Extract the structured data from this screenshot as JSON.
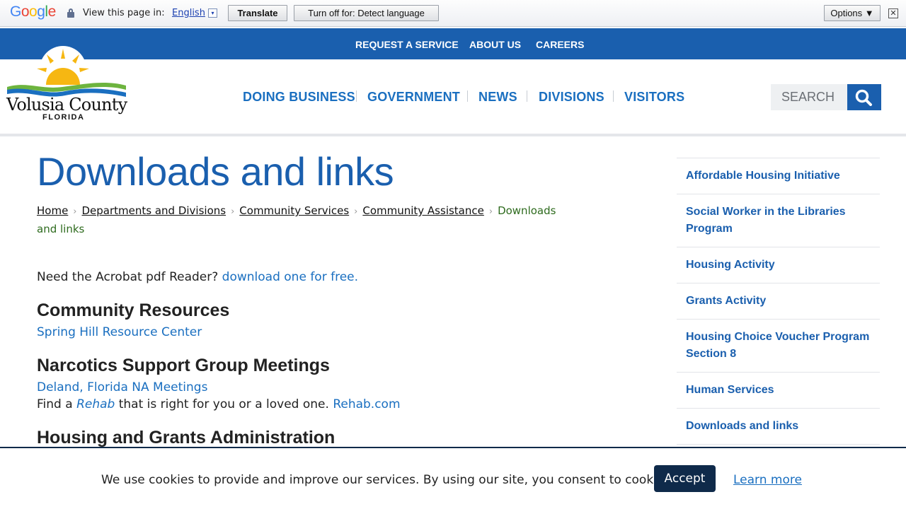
{
  "translate_bar": {
    "logo_letters": [
      "G",
      "o",
      "o",
      "g",
      "l",
      "e"
    ],
    "view_label": "View this page in:",
    "language": "English",
    "language_arrow": "▾",
    "translate_button": "Translate",
    "turn_off_button": "Turn off for: Detect language",
    "options_button": "Options ▼",
    "close": "✕"
  },
  "utility_nav": [
    "REQUEST A SERVICE",
    "ABOUT US",
    "CAREERS"
  ],
  "logo": {
    "line1": "Volusia County",
    "line2": "FLORIDA",
    "colors": {
      "sun": "#f6b712",
      "wave_blue": "#1a6fc0",
      "wave_green": "#6db43e"
    }
  },
  "main_nav": [
    "DOING BUSINESS",
    "GOVERNMENT",
    "NEWS",
    "DIVISIONS",
    "VISITORS"
  ],
  "search": {
    "placeholder": "SEARCH",
    "icon": "search-icon"
  },
  "page": {
    "title": "Downloads and links",
    "breadcrumb": [
      "Home",
      "Departments and Divisions",
      "Community Services",
      "Community Assistance"
    ],
    "breadcrumb_current": "Downloads and links"
  },
  "content": {
    "acrobat_text": "Need the Acrobat pdf Reader?",
    "acrobat_link": "download one for free.",
    "section1_heading": "Community Resources",
    "section1_link": "Spring Hill Resource Center",
    "section2_heading": "Narcotics Support Group Meetings",
    "section2_link": "Deland, Florida NA Meetings",
    "rehab_prefix": "Find a",
    "rehab_italic": "Rehab",
    "rehab_middle": "that is right for you or a loved one.",
    "rehab_link": "Rehab.com",
    "section3_heading": "Housing and Grants Administration"
  },
  "sidebar": [
    "Affordable Housing Initiative",
    "Social Worker in the Libraries Program",
    "Housing Activity",
    "Grants Activity",
    "Housing Choice Voucher Program Section 8",
    "Human Services",
    "Downloads and links"
  ],
  "cookie": {
    "text": "We use cookies to provide and improve our services. By using our site, you consent to cookies.",
    "accept": "Accept",
    "learn_more": "Learn more"
  },
  "colors": {
    "primary_blue": "#1a5fae",
    "link_blue": "#1a6fc0",
    "breadcrumb_current": "#2e6b1e",
    "cookie_dark": "#0f2a4a"
  }
}
